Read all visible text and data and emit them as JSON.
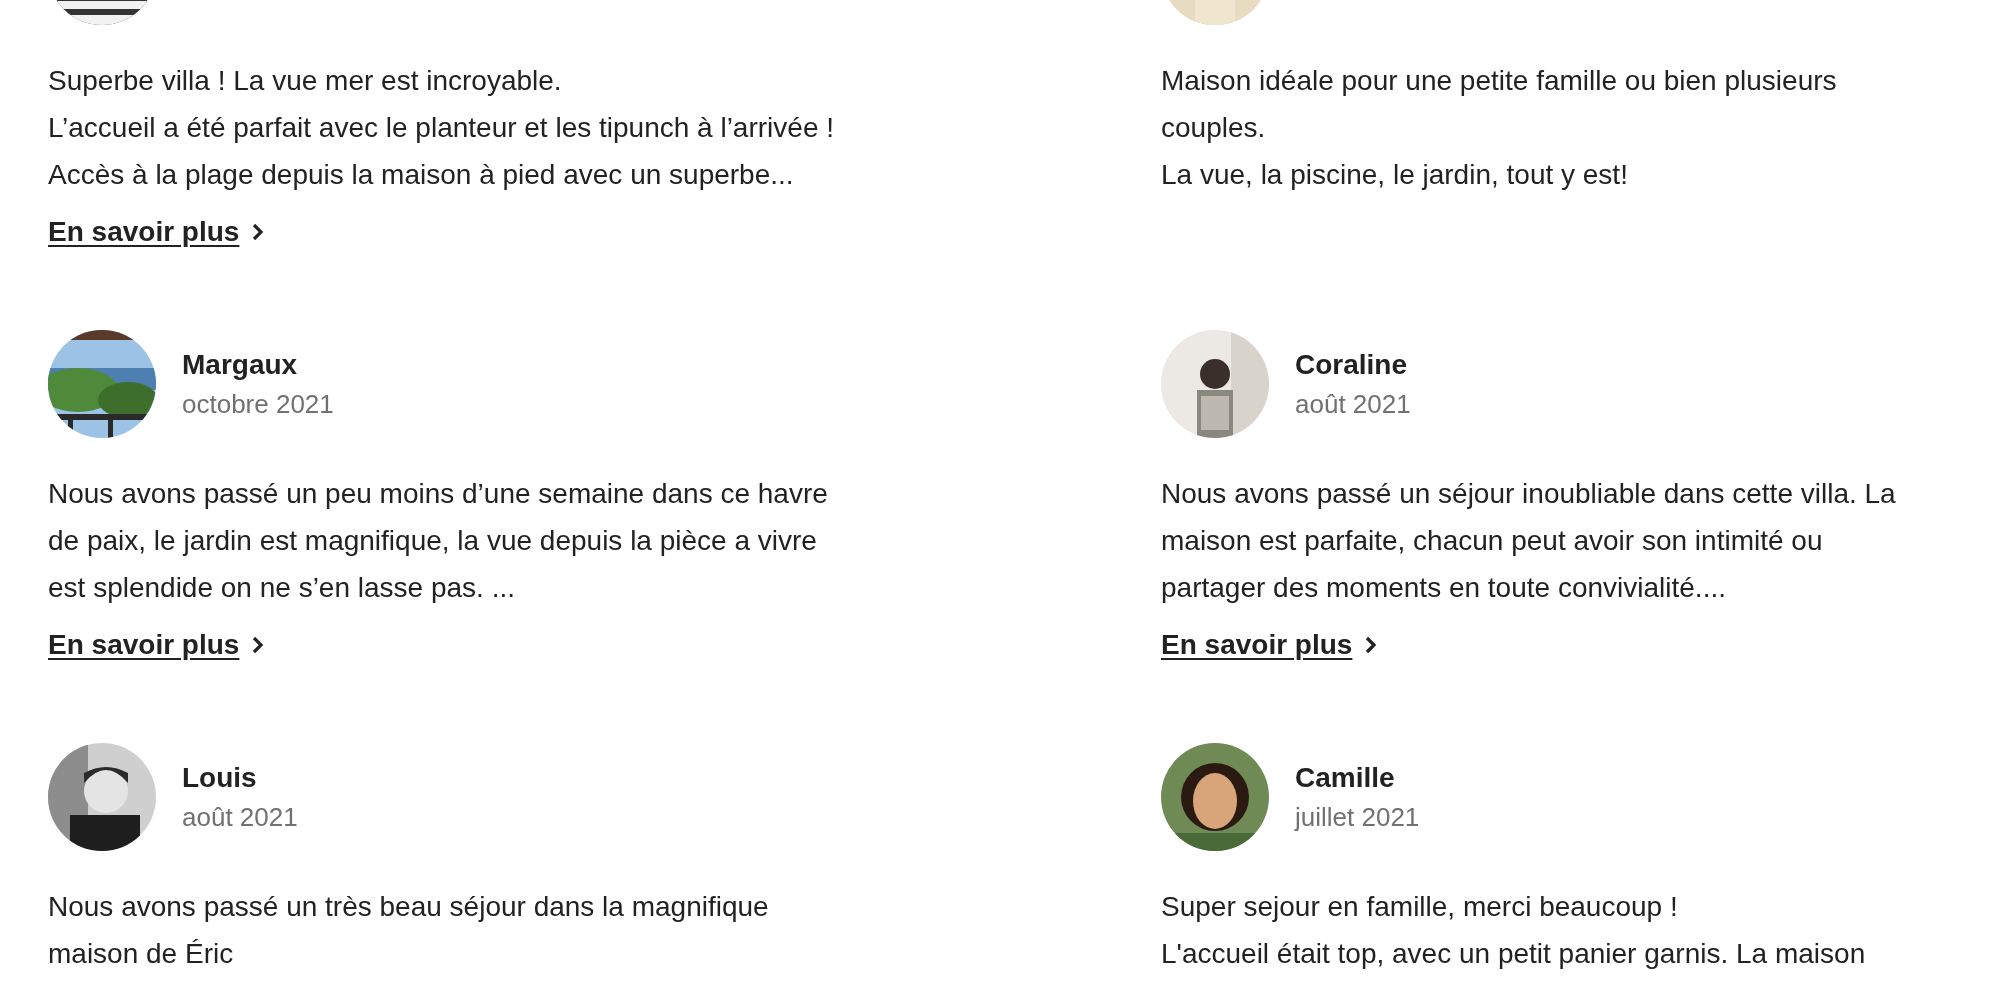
{
  "reviews": [
    {
      "lines": [
        "Superbe villa ! La vue mer est incroyable.",
        "L’accueil a été parfait avec le planteur et les tipunch à l’arrivée !",
        "Accès à la plage depuis la maison à pied avec un superbe..."
      ],
      "more_link": "En savoir plus"
    },
    {
      "lines": [
        "Maison idéale pour une petite famille ou bien plusieurs",
        "couples.",
        "La vue, la piscine, le jardin, tout y est!"
      ]
    },
    {
      "name": "Margaux",
      "date": "octobre 2021",
      "lines": [
        "Nous avons passé un peu moins d’une semaine dans ce havre",
        "de paix, le jardin est magnifique, la vue depuis la pièce a vivre",
        "est splendide on ne s’en lasse pas. ..."
      ],
      "more_link": "En savoir plus"
    },
    {
      "name": "Coraline",
      "date": "août 2021",
      "lines": [
        "Nous avons passé un séjour inoubliable dans cette villa. La",
        "maison est parfaite, chacun peut avoir son intimité ou",
        "partager des moments en toute convivialité...."
      ],
      "more_link": "En savoir plus"
    },
    {
      "name": "Louis",
      "date": "août 2021",
      "lines": [
        "Nous avons passé un très beau séjour dans la magnifique",
        "maison de Éric"
      ]
    },
    {
      "name": "Camille",
      "date": "juillet 2021",
      "lines": [
        "Super sejour en famille, merci beaucoup !",
        "L'accueil était top, avec un petit panier garnis. La maison"
      ]
    }
  ]
}
